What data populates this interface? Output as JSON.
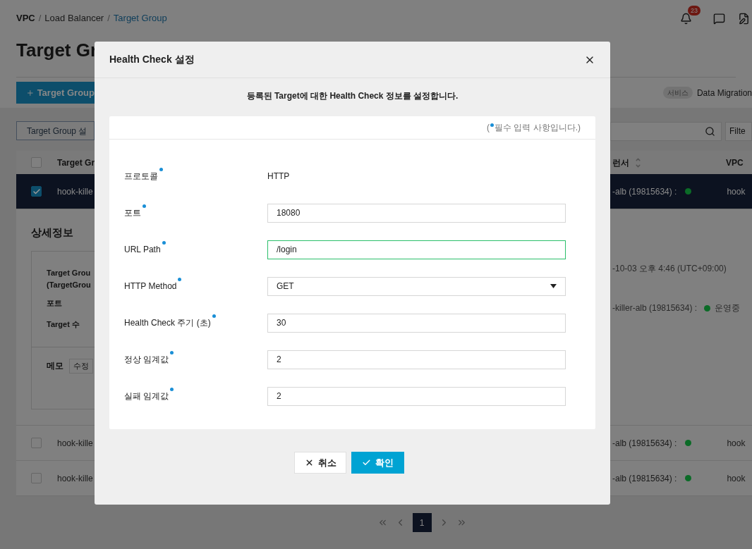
{
  "breadcrumb": [
    {
      "label": "VPC",
      "kind": "root"
    },
    {
      "label": "Load Balancer",
      "kind": "link"
    },
    {
      "label": "Target Group",
      "kind": "current"
    }
  ],
  "breadcrumb_separator": "/",
  "notifications": {
    "count": "23"
  },
  "page_title": "Target Gr",
  "create_button": "Target Group",
  "service_tag": {
    "badge": "서비스",
    "text": "Data Migration"
  },
  "settings_button": "Target Group 설",
  "filter_button": "Filte",
  "table": {
    "header": {
      "checked": false,
      "name": "Target Gr",
      "balancer": "런서",
      "vpc": "VPC"
    },
    "rows": [
      {
        "checked": true,
        "selected": true,
        "name": "hook-kille",
        "balancer": "-alb (19815634) :",
        "color": "#0b6b27",
        "vpc": "hook"
      },
      {
        "checked": false,
        "selected": false,
        "name": "hook-kille",
        "balancer": "-alb (19815634) :",
        "color": "#0b6b27",
        "vpc": "hook"
      },
      {
        "checked": false,
        "selected": false,
        "name": "hook-kille",
        "balancer": "-alb (19815634) :",
        "color": "#0b6b27",
        "vpc": "hook"
      }
    ]
  },
  "detail": {
    "title": "상세정보",
    "name_label": [
      "Target Grou",
      "(TargetGrou"
    ],
    "port_label": "포트",
    "count_label": "Target 수",
    "created": "-10-03 오후 4:46 (UTC+09:00)",
    "balancer": "-killer-alb (19815634) :",
    "status": {
      "color": "#0b6b27",
      "text": "운영중"
    },
    "memo_label": "메모",
    "memo_button": "수정"
  },
  "pagination": {
    "pages": [
      {
        "label": "1",
        "selected": true
      }
    ]
  },
  "dialog": {
    "title": "Health Check 설정",
    "description": "등록된 Target에 대한 Health Check 정보를 설정합니다.",
    "required_note": [
      "(",
      "필수 입력 사항입니다.)"
    ],
    "fields": [
      {
        "label": "프로토콜",
        "required": true,
        "kind": "text",
        "value": "HTTP"
      },
      {
        "label": "포트",
        "required": true,
        "kind": "input",
        "value": "18080",
        "focused": false
      },
      {
        "label": "URL Path",
        "required": true,
        "kind": "input",
        "value": "/login",
        "focused": true
      },
      {
        "label": "HTTP Method",
        "required": true,
        "kind": "select",
        "value": "GET",
        "focused": false
      },
      {
        "label": "Health Check 주기 (초)",
        "required": true,
        "kind": "input",
        "value": "30",
        "focused": false
      },
      {
        "label": "정상 임계값",
        "required": true,
        "kind": "input",
        "value": "2",
        "focused": false
      },
      {
        "label": "실패 임계값",
        "required": true,
        "kind": "input",
        "value": "2",
        "focused": false
      }
    ],
    "buttons": [
      {
        "label": "취소",
        "kind": "cancel"
      },
      {
        "label": "확인",
        "kind": "confirm"
      }
    ]
  }
}
